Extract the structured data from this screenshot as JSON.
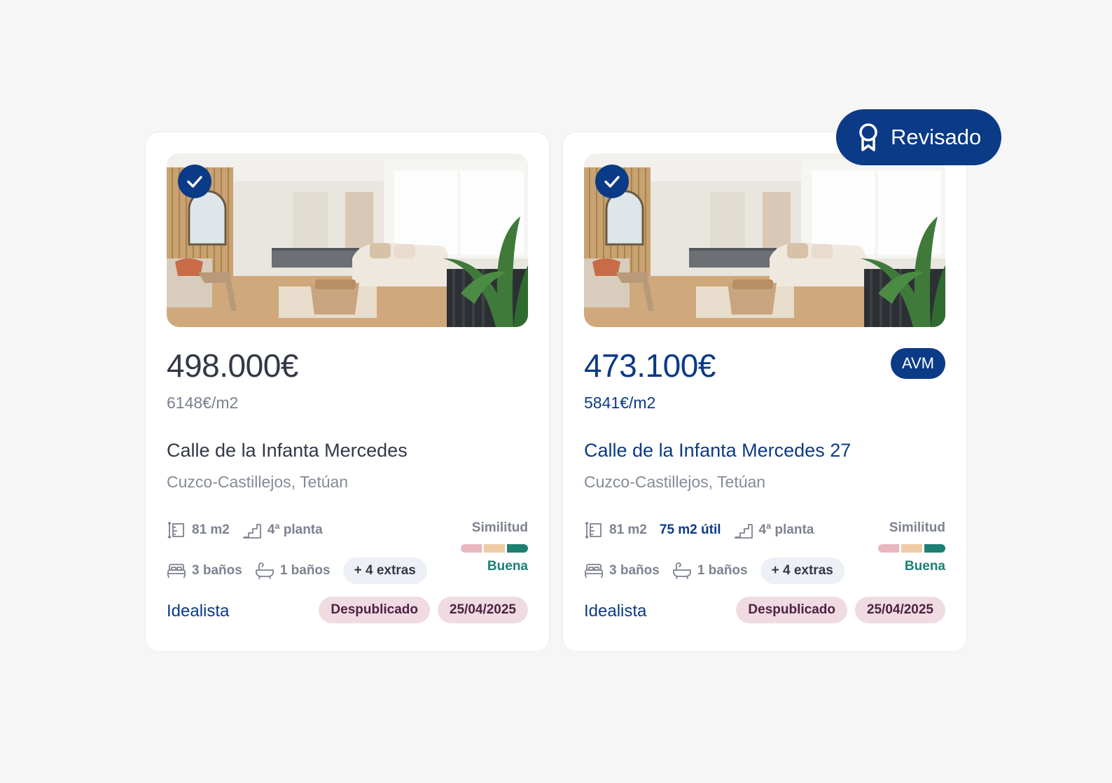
{
  "listings": [
    {
      "price": "498.000€",
      "price_per_m2": "6148€/m2",
      "street": "Calle de la Infanta Mercedes",
      "neighborhood": "Cuzco-Castillejos, Tetúan",
      "area": "81 m2",
      "floor": "4ª planta",
      "bedrooms": "3 baños",
      "bathrooms": "1 baños",
      "extras": "+ 4 extras",
      "similarity_label": "Similitud",
      "similarity_value": "Buena",
      "source": "Idealista",
      "status": "Despublicado",
      "date": "25/04/2025",
      "selected": true
    },
    {
      "price": "473.100€",
      "price_per_m2": "5841€/m2",
      "street": "Calle de la Infanta Mercedes 27",
      "neighborhood": "Cuzco-Castillejos, Tetúan",
      "area": "81 m2",
      "usable_area": "75 m2 útil",
      "floor": "4ª planta",
      "bedrooms": "3 baños",
      "bathrooms": "1 baños",
      "extras": "+ 4 extras",
      "similarity_label": "Similitud",
      "similarity_value": "Buena",
      "source": "Idealista",
      "status": "Despublicado",
      "date": "25/04/2025",
      "badge": "AVM",
      "selected": true
    }
  ],
  "reviewed_badge": {
    "label": "Revisado",
    "icon": "award-ribbon-icon"
  },
  "similarity_scale": {
    "level": 3,
    "of": 3
  },
  "icons": {
    "selected": "check-icon",
    "area": "area-ruler-icon",
    "floor": "stairs-icon",
    "bedrooms": "bed-icon",
    "bathrooms": "bathtub-icon"
  },
  "colors": {
    "brand": "#0b3a87",
    "good": "#1e7f74",
    "sim_bad": "#e9b7bf",
    "sim_mid": "#efcca6",
    "sim_good": "#1e7f74",
    "tag_bg": "#f0dbe3",
    "tag_text": "#4b2340"
  }
}
